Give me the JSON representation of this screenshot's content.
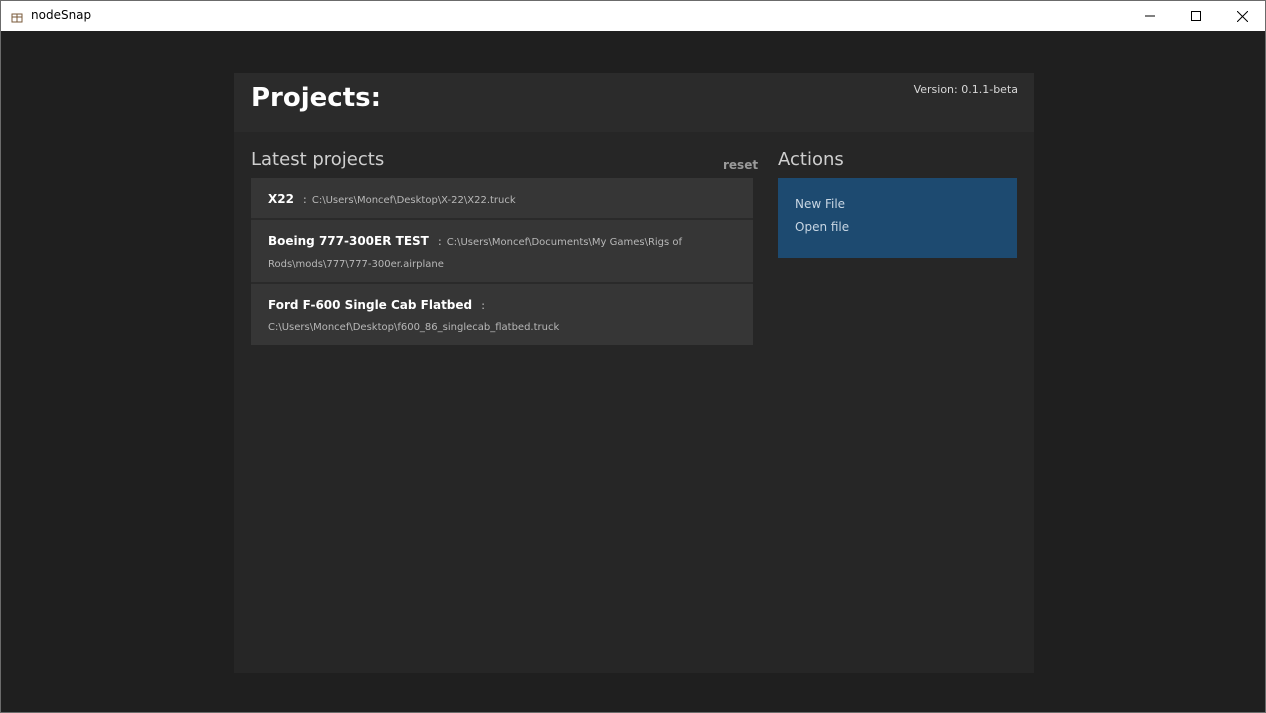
{
  "window": {
    "title": "nodeSnap",
    "minimize_icon": "minimize-icon",
    "maximize_icon": "maximize-icon",
    "close_icon": "close-icon",
    "app_icon": "app-icon"
  },
  "header": {
    "title": "Projects:",
    "version": "Version: 0.1.1-beta"
  },
  "latest": {
    "title": "Latest projects",
    "reset_label": "reset",
    "projects": [
      {
        "name": "X22",
        "separator": ":",
        "path": "C:\\Users\\Moncef\\Desktop\\X-22\\X22.truck"
      },
      {
        "name": "Boeing 777-300ER TEST",
        "separator": ":",
        "path": "C:\\Users\\Moncef\\Documents\\My Games\\Rigs of Rods\\mods\\777\\777-300er.airplane"
      },
      {
        "name": "Ford F-600 Single Cab Flatbed",
        "separator": ":",
        "path": "C:\\Users\\Moncef\\Desktop\\f600_86_singlecab_flatbed.truck"
      }
    ]
  },
  "actions": {
    "title": "Actions",
    "new_file": "New File",
    "open_file": "Open file"
  },
  "colors": {
    "background": "#1f1f1f",
    "panel": "#262626",
    "project_item": "#363636",
    "actions_box": "#1d4a70"
  }
}
